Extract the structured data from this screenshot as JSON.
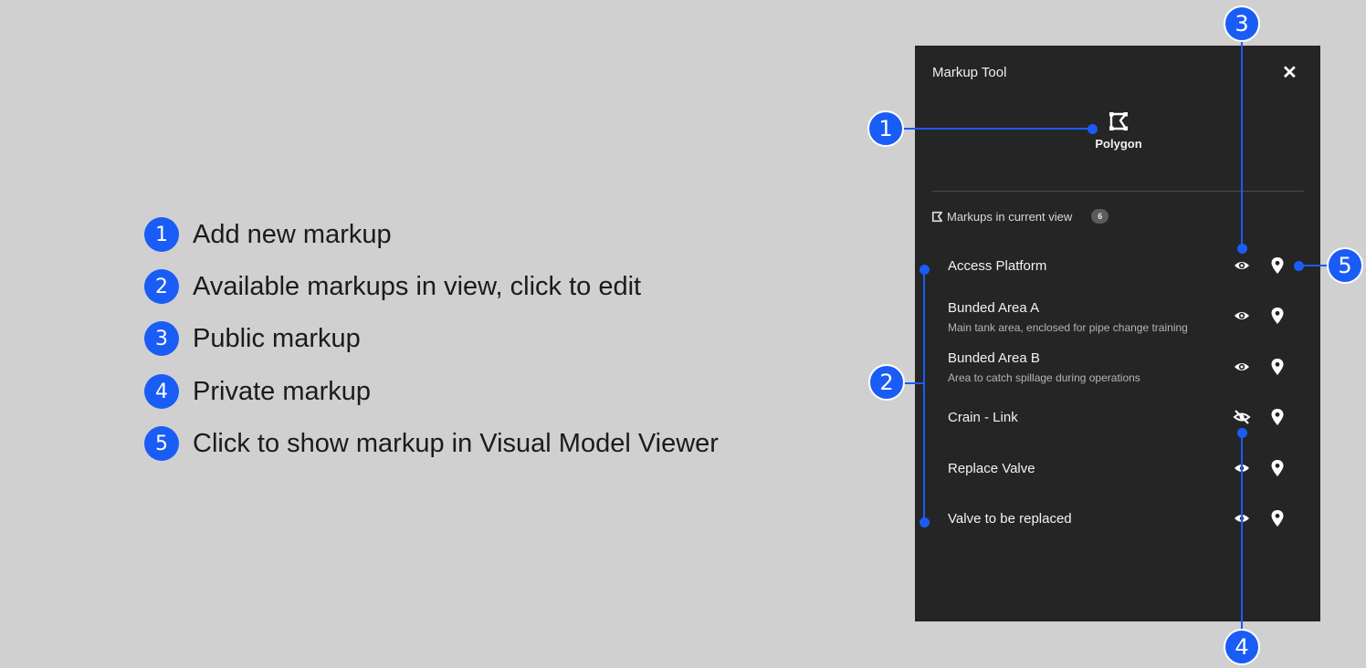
{
  "legend": [
    {
      "num": "1",
      "text": "Add new markup"
    },
    {
      "num": "2",
      "text": "Available markups in view, click to edit"
    },
    {
      "num": "3",
      "text": "Public markup"
    },
    {
      "num": "4",
      "text": "Private markup"
    },
    {
      "num": "5",
      "text": "Click to show markup in Visual Model Viewer"
    }
  ],
  "panel": {
    "title": "Markup Tool",
    "close_icon": "close-icon",
    "tool_label": "Polygon",
    "tool_icon": "polygon-icon",
    "section_title": "Markups in current view",
    "count": "6",
    "items": [
      {
        "title": "Access Platform",
        "description": "",
        "visibility": "public"
      },
      {
        "title": "Bunded Area A",
        "description": "Main tank area, enclosed for pipe change training",
        "visibility": "public"
      },
      {
        "title": "Bunded Area B",
        "description": "Area to catch spillage during operations",
        "visibility": "public"
      },
      {
        "title": "Crain - Link",
        "description": "",
        "visibility": "hidden"
      },
      {
        "title": "Replace Valve",
        "description": "",
        "visibility": "private"
      },
      {
        "title": "Valve to be replaced",
        "description": "",
        "visibility": "private"
      }
    ]
  },
  "callouts": [
    "1",
    "2",
    "3",
    "4",
    "5"
  ],
  "colors": {
    "accent": "#1a5cf6",
    "panel_bg": "#252526",
    "page_bg": "#d0d0d0"
  }
}
